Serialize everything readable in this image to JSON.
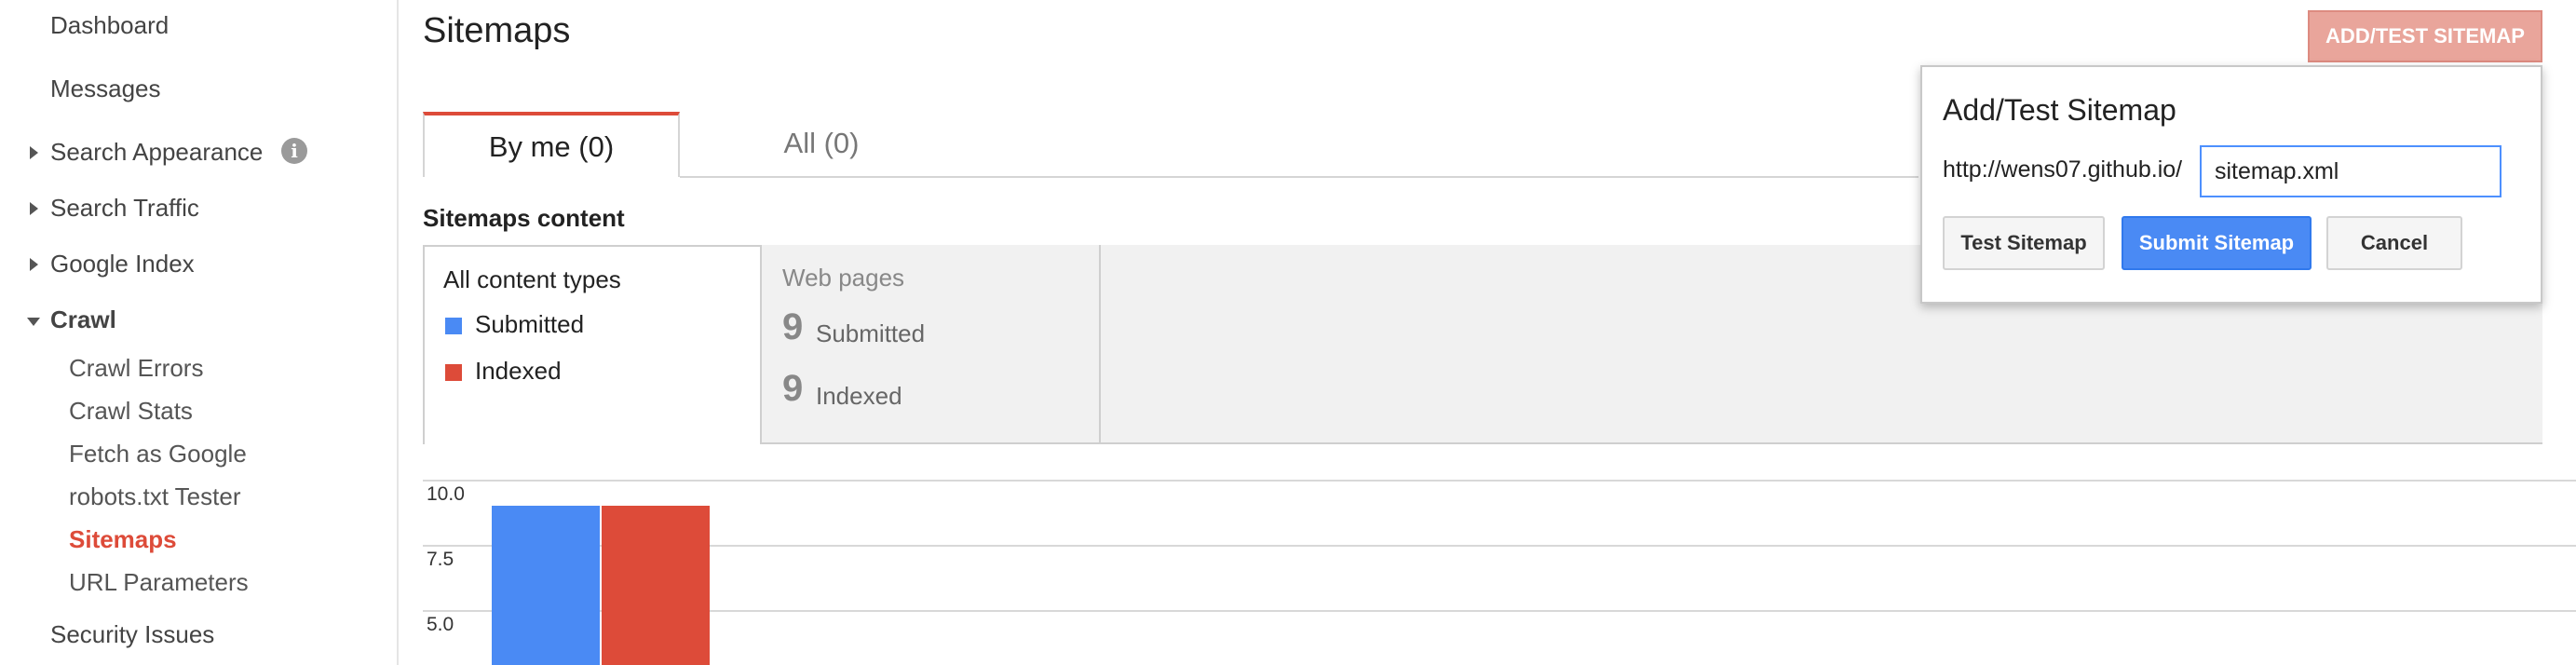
{
  "sidebar": {
    "dashboard": "Dashboard",
    "messages": "Messages",
    "search_appearance": "Search Appearance",
    "search_traffic": "Search Traffic",
    "google_index": "Google Index",
    "crawl": "Crawl",
    "crawl_items": {
      "crawl_errors": "Crawl Errors",
      "crawl_stats": "Crawl Stats",
      "fetch_as_google": "Fetch as Google",
      "robots_tester": "robots.txt Tester",
      "sitemaps": "Sitemaps",
      "url_parameters": "URL Parameters"
    },
    "security_issues": "Security Issues"
  },
  "main": {
    "title": "Sitemaps",
    "tabs": {
      "by_me": "By me (0)",
      "all": "All (0)"
    },
    "content_heading": "Sitemaps content",
    "panel_all": {
      "title": "All content types",
      "submitted": "Submitted",
      "indexed": "Indexed"
    },
    "panel_web": {
      "title": "Web pages",
      "submitted_count": "9",
      "submitted_label": "Submitted",
      "indexed_count": "9",
      "indexed_label": "Indexed"
    }
  },
  "colors": {
    "submitted": "#4a8af4",
    "indexed": "#dd4b39",
    "accent": "#dd4b39"
  },
  "chart_data": {
    "type": "bar",
    "series": [
      {
        "name": "Submitted",
        "values": [
          9
        ]
      },
      {
        "name": "Indexed",
        "values": [
          9
        ]
      }
    ],
    "y_ticks": [
      "10.0",
      "7.5",
      "5.0"
    ],
    "ylim_visible": [
      5.0,
      10.0
    ]
  },
  "add_button": "ADD/TEST SITEMAP",
  "dialog": {
    "title": "Add/Test Sitemap",
    "prefix": "http://wens07.github.io/",
    "input_value": "sitemap.xml",
    "test_button": "Test Sitemap",
    "submit_button": "Submit Sitemap",
    "cancel_button": "Cancel"
  }
}
